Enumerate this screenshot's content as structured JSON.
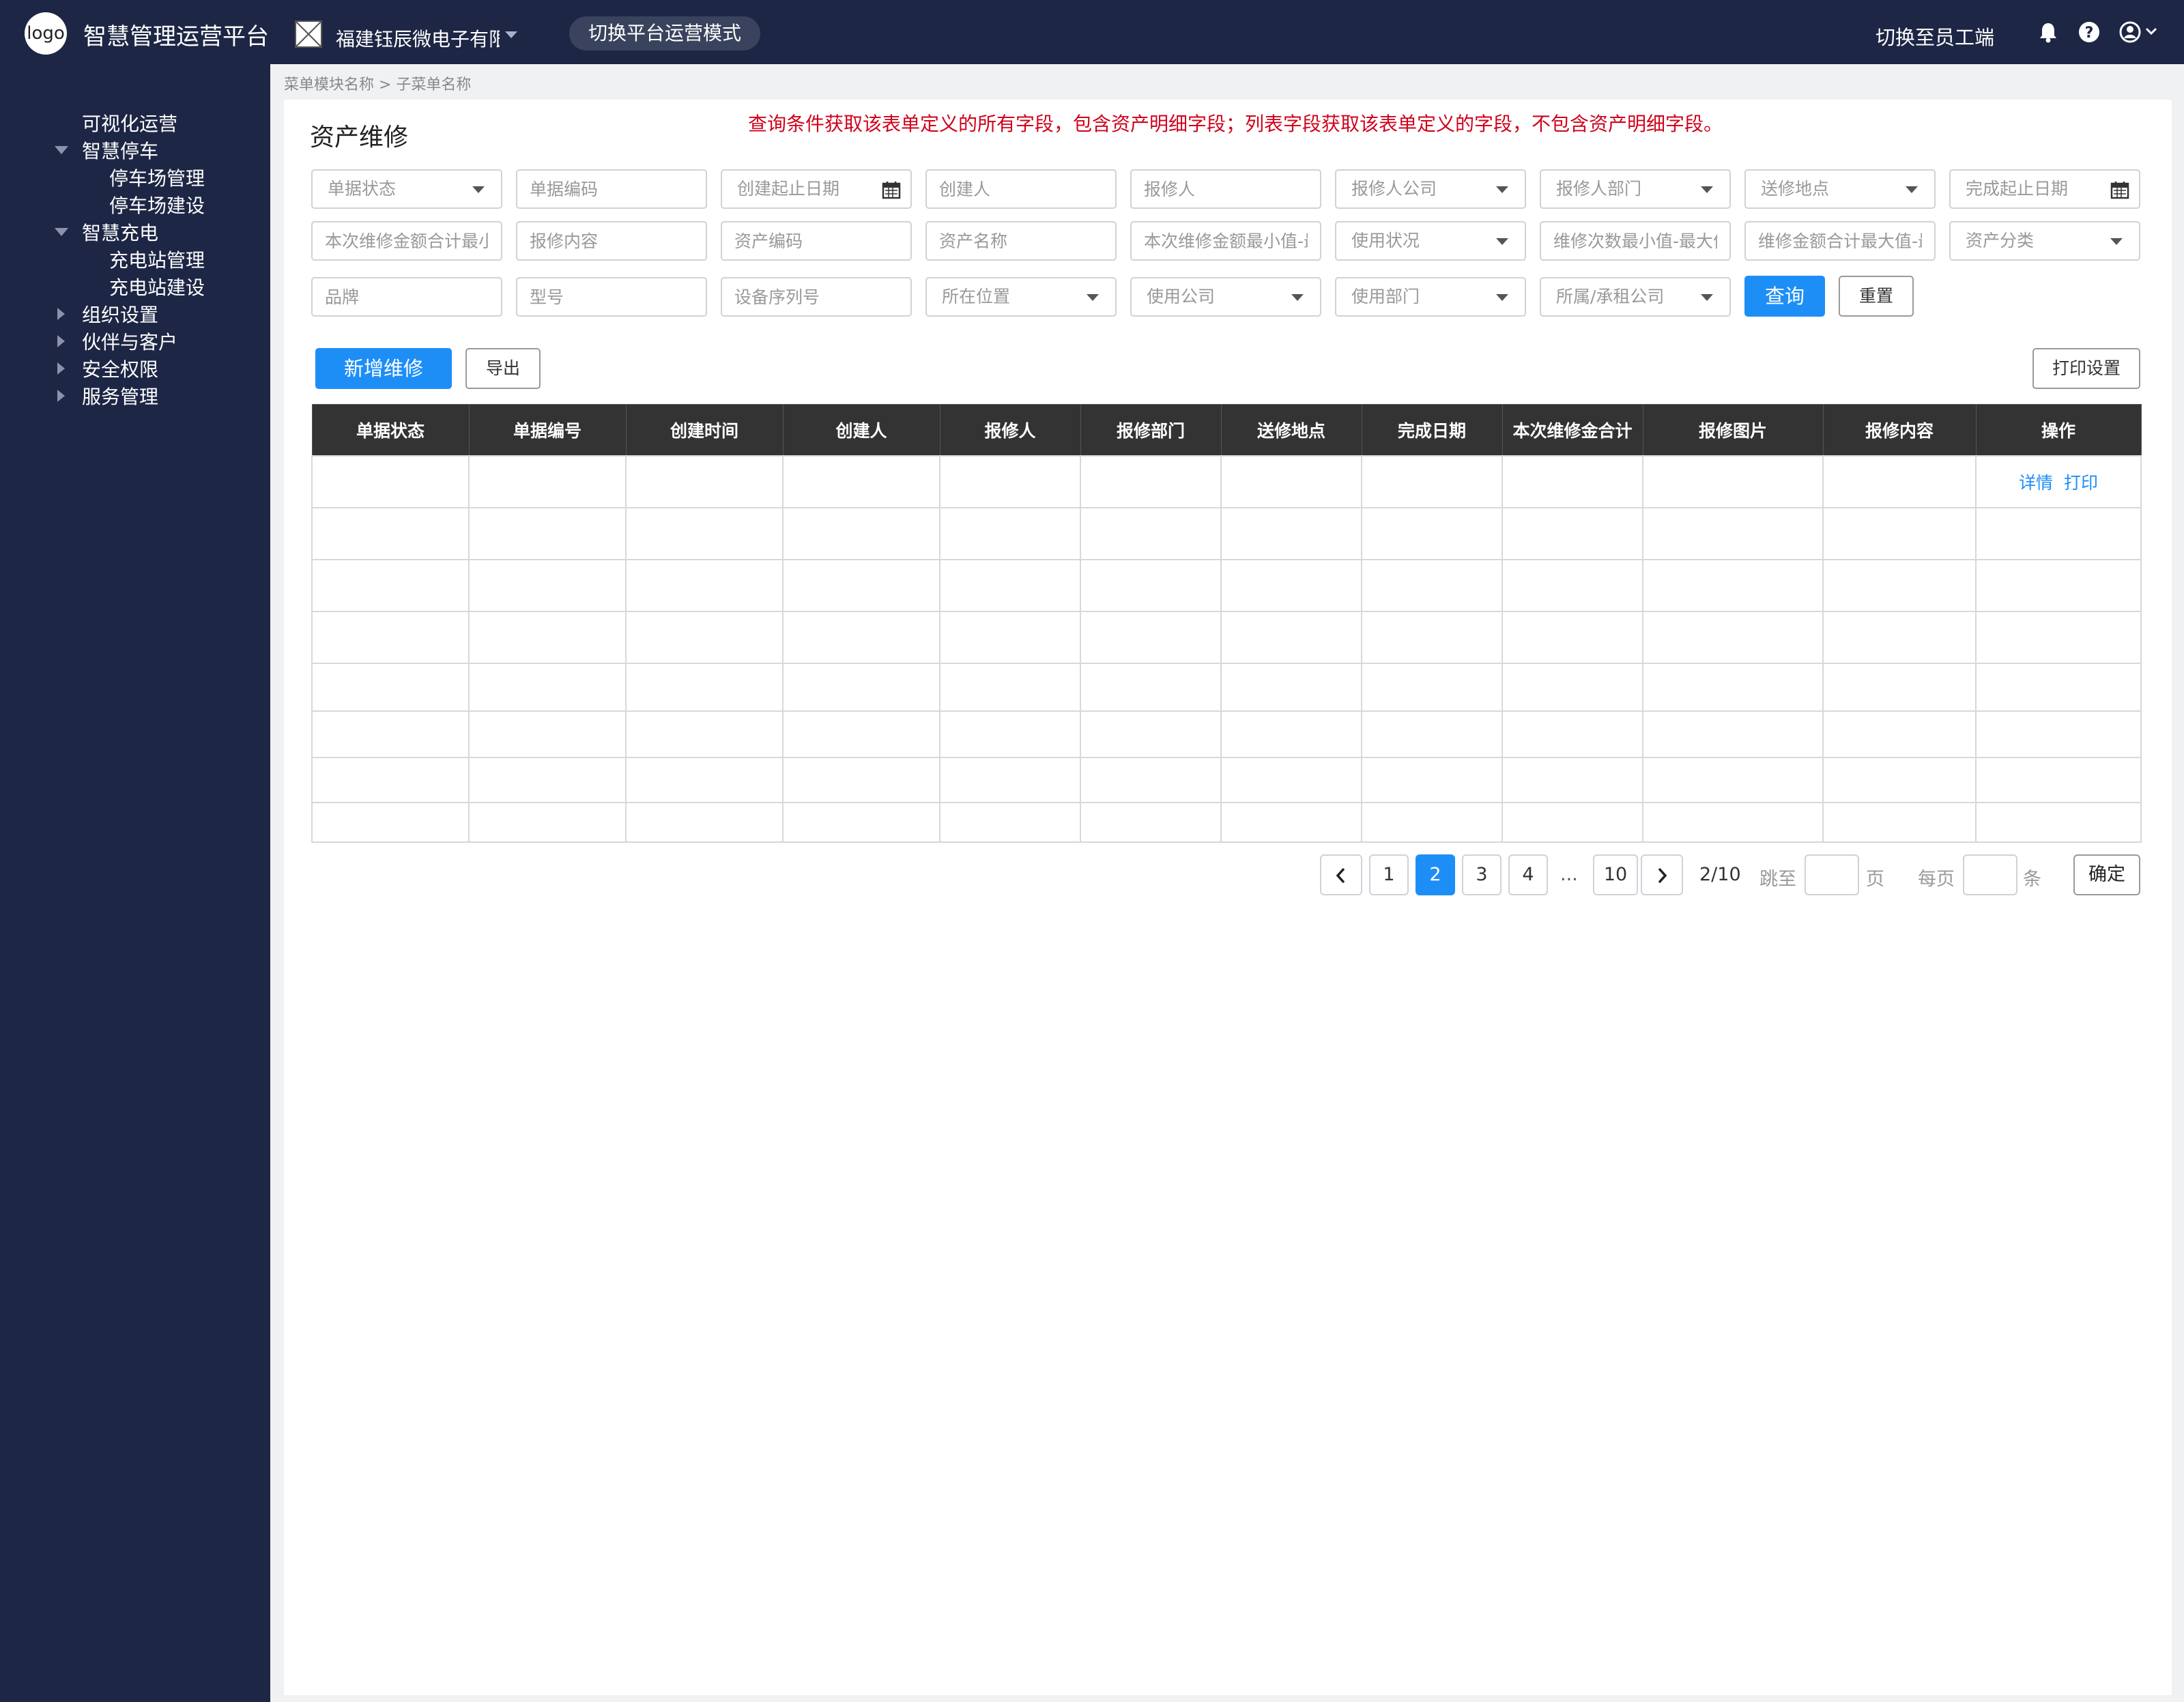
{
  "header": {
    "logo": "logo",
    "app_title": "智慧管理运营平台",
    "company_name": "福建钰辰微电子有限公司",
    "mode_switch": "切换平台运营模式",
    "switch_staff": "切换至员工端",
    "icons": [
      "bell-icon",
      "help-icon",
      "user-icon",
      "chevron-down-icon"
    ]
  },
  "sidebar": {
    "items": [
      {
        "label": "可视化运营"
      },
      {
        "label": "智慧停车",
        "expanded": true,
        "children": [
          "停车场管理",
          "停车场建设"
        ]
      },
      {
        "label": "智慧充电",
        "expanded": true,
        "children": [
          "充电站管理",
          "充电站建设"
        ]
      },
      {
        "label": "组织设置"
      },
      {
        "label": "伙伴与客户"
      },
      {
        "label": "安全权限"
      },
      {
        "label": "服务管理"
      }
    ]
  },
  "breadcrumb": "菜单模块名称 > 子菜单名称",
  "page": {
    "title": "资产维修",
    "notice": "查询条件获取该表单定义的所有字段，包含资产明细字段；列表字段获取该表单定义的字段，不包含资产明细字段。"
  },
  "filters": {
    "row1": [
      "单据状态",
      "单据编码",
      "创建起止日期",
      "创建人",
      "报修人",
      "报修人公司",
      "报修人部门",
      "送修地点",
      "完成起止日期"
    ],
    "row2": [
      "本次维修金额合计最小值-最大值",
      "报修内容",
      "资产编码",
      "资产名称",
      "本次维修金额最小值-最大值",
      "使用状况",
      "维修次数最小值-最大值",
      "维修金额合计最大值-最小值",
      "资产分类"
    ],
    "row3": [
      "品牌",
      "型号",
      "设备序列号",
      "所在位置",
      "使用公司",
      "使用部门",
      "所属/承租公司"
    ],
    "query_btn": "查询",
    "reset_btn": "重置"
  },
  "toolbar": {
    "add_btn": "新增维修",
    "export_btn": "导出",
    "print_settings_btn": "打印设置"
  },
  "table": {
    "columns": [
      "单据状态",
      "单据编号",
      "创建时间",
      "创建人",
      "报修人",
      "报修部门",
      "送修地点",
      "完成日期",
      "本次维修金合计",
      "报修图片",
      "报修内容",
      "操作"
    ],
    "actions": [
      "详情",
      "打印"
    ]
  },
  "pagination": {
    "pages": [
      "1",
      "2",
      "3",
      "4",
      "...",
      "10"
    ],
    "current": 2,
    "total_pages": 10,
    "status": "2/10",
    "jump_label": "跳至",
    "page_unit": "页",
    "per_page_label": "每页",
    "item_unit": "条",
    "confirm": "确定"
  },
  "colors": {
    "nav_bg": "#1d2644",
    "primary": "#1e8ef7",
    "notice_red": "#d0021b",
    "table_header": "#333333"
  }
}
